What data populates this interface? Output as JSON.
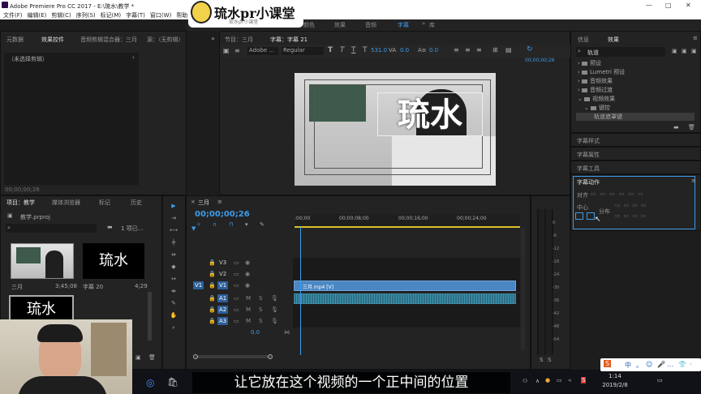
{
  "app": {
    "title": "Adobe Premiere Pro CC 2017 - E:\\琉水\\教学 *"
  },
  "menu": [
    "文件(F)",
    "编辑(E)",
    "剪辑(C)",
    "序列(S)",
    "标记(M)",
    "字幕(T)",
    "窗口(W)",
    "帮助(H)"
  ],
  "logo": {
    "text": "琉水pr小课堂",
    "sub": "琉水pr小课堂"
  },
  "workspaces": [
    {
      "label": "组件",
      "active": false
    },
    {
      "label": "编辑",
      "active": false
    },
    {
      "label": "颜色",
      "active": false
    },
    {
      "label": "效果",
      "active": false
    },
    {
      "label": "音频",
      "active": false
    },
    {
      "label": "字幕",
      "active": true
    },
    {
      "label": "库",
      "active": false
    }
  ],
  "source_panel": {
    "tabs": [
      "元数据",
      "效果控件",
      "音频剪辑混合器：三月",
      "源：（无剪辑）"
    ],
    "no_clip": "（未选择剪辑）",
    "timecode": "00;00;00;26"
  },
  "program_panel": {
    "tabs": [
      "节目：三月",
      "字幕：字幕 21"
    ],
    "font": "Adobe ...",
    "style": "Regular",
    "font_size": "531.0",
    "kerning": "0.0",
    "leading": "0.0",
    "timecode": "00;00;00;26",
    "title_text": "琉水"
  },
  "right_panel": {
    "tabs": [
      "信息",
      "效果"
    ],
    "search": "轨道",
    "tree": [
      {
        "label": "预设",
        "indent": 0
      },
      {
        "label": "Lumetri 预设",
        "indent": 0
      },
      {
        "label": "音频效果",
        "indent": 0
      },
      {
        "label": "音频过渡",
        "indent": 0
      },
      {
        "label": "视频效果",
        "indent": 0
      },
      {
        "label": "键控",
        "indent": 1
      },
      {
        "label": "轨道遮罩键",
        "indent": 2
      }
    ],
    "sections": [
      "字幕样式",
      "字幕属性",
      "字幕工具"
    ],
    "actions": {
      "title": "字幕动作",
      "align": "对齐",
      "center": "中心",
      "distribute": "分布"
    }
  },
  "project_panel": {
    "tabs": [
      "项目：教学",
      "媒体浏览器",
      "标记",
      "历史"
    ],
    "file": "教学.prproj",
    "count": "1 项已...",
    "items": [
      {
        "name": "三月",
        "duration": "3;45;08",
        "kind": "image"
      },
      {
        "name": "字幕 20",
        "duration": "4;29",
        "kind": "title",
        "text": "琉水"
      },
      {
        "name": "",
        "duration": "",
        "kind": "title",
        "text": "琉水"
      }
    ]
  },
  "timeline": {
    "tab": "三月",
    "timecode": "00;00;00;26",
    "ruler": [
      ":00;00",
      "00;00;08;00",
      "00;00;16;00",
      "00;00;24;00"
    ],
    "tracks": [
      {
        "id": "V3",
        "src": ""
      },
      {
        "id": "V2",
        "src": ""
      },
      {
        "id": "V1",
        "src": "V1"
      },
      {
        "id": "A1",
        "src": ""
      },
      {
        "id": "A2",
        "src": ""
      },
      {
        "id": "A3",
        "src": ""
      }
    ],
    "master": "0.0",
    "clip_label": "三月.mp4 [V]"
  },
  "meter": {
    "scale": [
      "0",
      "-6",
      "-12",
      "-18",
      "-24",
      "-30",
      "-36",
      "-42",
      "-48",
      "-54"
    ],
    "footer": [
      "S",
      "S"
    ]
  },
  "taskbar": {
    "time": "1:14",
    "date": "2019/2/8"
  },
  "subtitle": "让它放在这个视频的一个正中间的位置",
  "ime": [
    "S",
    "中",
    "。",
    "…",
    "·"
  ],
  "colors": {
    "accent": "#3d9be9",
    "clip_video": "#4a87c4",
    "clip_audio": "#2d6f86",
    "playhead": "#3d9be9"
  }
}
